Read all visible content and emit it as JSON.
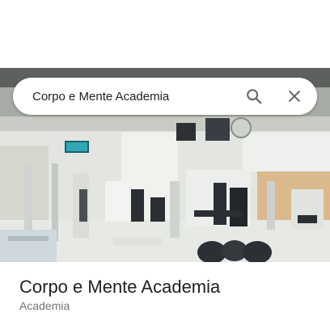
{
  "search": {
    "query": "Corpo e Mente Academia",
    "search_icon": "search-icon",
    "close_icon": "close-icon"
  },
  "place": {
    "name": "Corpo e Mente Academia",
    "category": "Academia"
  },
  "photo": {
    "subject": "gym-interior"
  },
  "colors": {
    "text_primary": "#202124",
    "text_secondary": "#70757a",
    "icon_gray": "#5f6368"
  }
}
